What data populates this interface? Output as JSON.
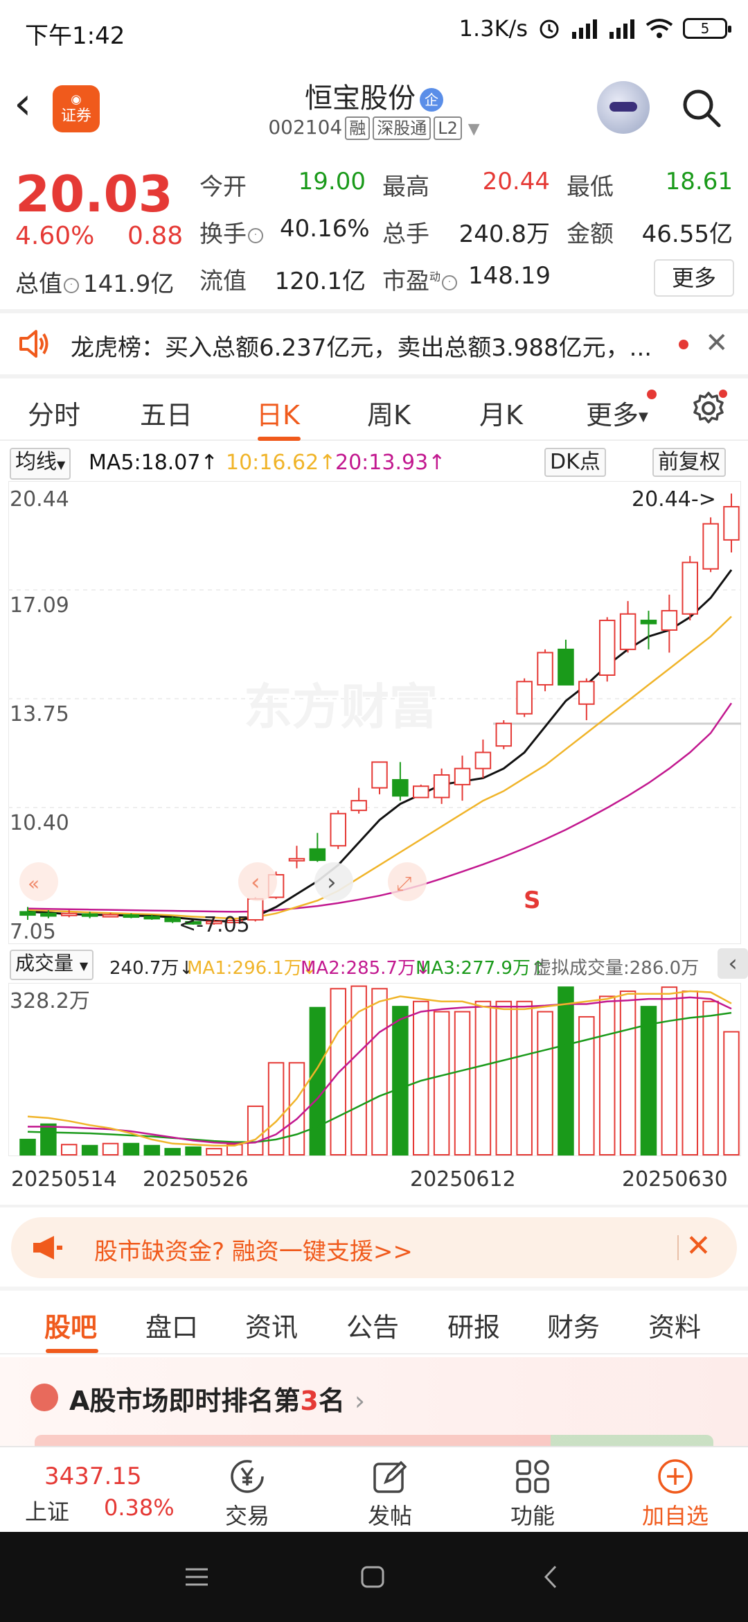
{
  "status_bar": {
    "time": "下午1:42",
    "net_speed": "1.3K/s",
    "battery": "5"
  },
  "header": {
    "app_logo_label": "证券",
    "stock_name": "恒宝股份",
    "qi_badge": "企",
    "stock_code": "002104",
    "tags": [
      "融",
      "深股通",
      "L2"
    ]
  },
  "quote": {
    "price": "20.03",
    "change_pct": "4.60%",
    "change": "0.88",
    "stats": [
      {
        "label": "今开",
        "value": "19.00",
        "color": "#1a9a1a"
      },
      {
        "label": "最高",
        "value": "20.44",
        "color": "#e53935"
      },
      {
        "label": "最低",
        "value": "18.61",
        "color": "#1a9a1a"
      },
      {
        "label": "换手",
        "value": "40.16%",
        "color": "#222222"
      },
      {
        "label": "总手",
        "value": "240.8万",
        "color": "#222222"
      },
      {
        "label": "金额",
        "value": "46.55亿",
        "color": "#222222"
      },
      {
        "label": "流值",
        "value": "120.1亿",
        "color": "#222222"
      },
      {
        "label": "市盈",
        "value": "148.19",
        "color": "#222222"
      }
    ],
    "total_cap_label": "总值",
    "total_cap_value": "141.9亿",
    "pe_superscript": "动",
    "more_label": "更多"
  },
  "dragon_tiger": {
    "text": "龙虎榜：买入总额6.237亿元，卖出总额3.988亿元，..."
  },
  "period_tabs": [
    "分时",
    "五日",
    "日K",
    "周K",
    "月K",
    "更多"
  ],
  "period_active": "日K",
  "ma_legend": {
    "selector": "均线",
    "ma5": "MA5:18.07",
    "ma10": "10:16.62",
    "ma20": "20:13.93",
    "dk_button": "DK点",
    "adjust_button": "前复权"
  },
  "colors": {
    "up": "#e53935",
    "down": "#1a9a1a",
    "ma5": "#111111",
    "ma10": "#f0b429",
    "ma20": "#c2188f",
    "accent": "#f05a1c"
  },
  "kline_axis": {
    "y_ticks": [
      "20.44",
      "17.09",
      "13.75",
      "10.40",
      "7.05"
    ],
    "high_marker": "20.44->",
    "low_marker": "<-7.05",
    "watermark": "东方财富",
    "sell_marker": "S"
  },
  "chart_data": {
    "type": "candlestick",
    "ylim": [
      7.05,
      20.44
    ],
    "candles": [
      {
        "o": 7.45,
        "c": 7.35,
        "h": 7.6,
        "l": 7.2
      },
      {
        "o": 7.4,
        "c": 7.32,
        "h": 7.5,
        "l": 7.25
      },
      {
        "o": 7.35,
        "c": 7.4,
        "h": 7.5,
        "l": 7.28
      },
      {
        "o": 7.38,
        "c": 7.32,
        "h": 7.45,
        "l": 7.25
      },
      {
        "o": 7.33,
        "c": 7.36,
        "h": 7.42,
        "l": 7.28
      },
      {
        "o": 7.35,
        "c": 7.3,
        "h": 7.4,
        "l": 7.25
      },
      {
        "o": 7.3,
        "c": 7.25,
        "h": 7.36,
        "l": 7.2
      },
      {
        "o": 7.25,
        "c": 7.15,
        "h": 7.3,
        "l": 7.1
      },
      {
        "o": 7.14,
        "c": 7.1,
        "h": 7.2,
        "l": 7.05
      },
      {
        "o": 7.1,
        "c": 7.15,
        "h": 7.2,
        "l": 7.05
      },
      {
        "o": 7.14,
        "c": 7.18,
        "h": 7.22,
        "l": 7.1
      },
      {
        "o": 7.2,
        "c": 7.85,
        "h": 7.9,
        "l": 7.15
      },
      {
        "o": 7.9,
        "c": 8.6,
        "h": 8.7,
        "l": 7.85
      },
      {
        "o": 9.1,
        "c": 9.1,
        "h": 9.5,
        "l": 8.8
      },
      {
        "o": 9.4,
        "c": 9.05,
        "h": 9.9,
        "l": 9.0
      },
      {
        "o": 9.5,
        "c": 10.5,
        "h": 10.6,
        "l": 9.4
      },
      {
        "o": 10.6,
        "c": 10.9,
        "h": 11.3,
        "l": 10.5
      },
      {
        "o": 11.3,
        "c": 12.1,
        "h": 12.1,
        "l": 11.1
      },
      {
        "o": 11.55,
        "c": 11.05,
        "h": 12.1,
        "l": 10.9
      },
      {
        "o": 11.0,
        "c": 11.35,
        "h": 11.4,
        "l": 11.0
      },
      {
        "o": 11.0,
        "c": 11.7,
        "h": 11.9,
        "l": 10.8
      },
      {
        "o": 11.4,
        "c": 11.9,
        "h": 12.3,
        "l": 10.9
      },
      {
        "o": 11.9,
        "c": 12.4,
        "h": 12.8,
        "l": 11.6
      },
      {
        "o": 12.6,
        "c": 13.3,
        "h": 13.4,
        "l": 12.5
      },
      {
        "o": 13.6,
        "c": 14.6,
        "h": 14.7,
        "l": 13.5
      },
      {
        "o": 14.5,
        "c": 15.5,
        "h": 15.6,
        "l": 14.3
      },
      {
        "o": 15.6,
        "c": 14.5,
        "h": 15.9,
        "l": 14.5
      },
      {
        "o": 13.9,
        "c": 14.6,
        "h": 14.7,
        "l": 13.4
      },
      {
        "o": 14.8,
        "c": 16.5,
        "h": 16.6,
        "l": 14.6
      },
      {
        "o": 15.6,
        "c": 16.7,
        "h": 17.1,
        "l": 15.5
      },
      {
        "o": 16.5,
        "c": 16.4,
        "h": 16.8,
        "l": 15.6
      },
      {
        "o": 16.2,
        "c": 16.8,
        "h": 17.3,
        "l": 15.5
      },
      {
        "o": 16.7,
        "c": 18.3,
        "h": 18.5,
        "l": 16.5
      },
      {
        "o": 18.1,
        "c": 19.5,
        "h": 19.7,
        "l": 18.0
      },
      {
        "o": 19.0,
        "c": 20.03,
        "h": 20.44,
        "l": 18.61
      }
    ],
    "ma5": [
      7.45,
      7.42,
      7.38,
      7.36,
      7.35,
      7.33,
      7.32,
      7.28,
      7.22,
      7.17,
      7.14,
      7.3,
      7.6,
      8.0,
      8.4,
      8.9,
      9.6,
      10.3,
      10.8,
      11.1,
      11.4,
      11.5,
      11.6,
      11.9,
      12.4,
      13.2,
      14.0,
      14.5,
      15.1,
      15.6,
      16.0,
      16.2,
      16.6,
      17.2,
      18.07
    ],
    "ma10": [
      7.5,
      7.48,
      7.46,
      7.43,
      7.41,
      7.39,
      7.37,
      7.34,
      7.3,
      7.27,
      7.24,
      7.28,
      7.4,
      7.6,
      7.8,
      8.1,
      8.5,
      8.9,
      9.3,
      9.7,
      10.1,
      10.5,
      10.9,
      11.2,
      11.6,
      12.0,
      12.5,
      13.0,
      13.5,
      14.0,
      14.5,
      15.0,
      15.5,
      16.0,
      16.62
    ],
    "ma20": [
      7.55,
      7.54,
      7.53,
      7.52,
      7.51,
      7.5,
      7.49,
      7.48,
      7.47,
      7.46,
      7.45,
      7.46,
      7.5,
      7.56,
      7.63,
      7.72,
      7.83,
      7.95,
      8.1,
      8.28,
      8.48,
      8.7,
      8.92,
      9.16,
      9.42,
      9.7,
      10.0,
      10.33,
      10.68,
      11.05,
      11.45,
      11.9,
      12.4,
      13.0,
      13.93
    ]
  },
  "volume": {
    "selector": "成交量",
    "current": "240.7万",
    "ma1": "MA1:296.1万",
    "ma2": "MA2:285.7万",
    "ma3": "MA3:277.9万",
    "virtual": "虚拟成交量:286.0万",
    "y_max_label": "328.2万",
    "ylim": [
      0,
      328.2
    ],
    "bars": [
      30,
      60,
      20,
      18,
      22,
      22,
      18,
      12,
      15,
      12,
      20,
      95,
      180,
      180,
      288,
      325,
      330,
      325,
      290,
      300,
      280,
      280,
      300,
      300,
      300,
      280,
      328,
      270,
      310,
      320,
      290,
      328,
      320,
      300,
      240.7
    ],
    "ma1_line": [
      75,
      72,
      66,
      58,
      52,
      42,
      30,
      22,
      20,
      18,
      18,
      30,
      65,
      110,
      170,
      240,
      280,
      300,
      310,
      305,
      300,
      300,
      290,
      285,
      285,
      290,
      295,
      300,
      305,
      315,
      315,
      315,
      320,
      318,
      296.1
    ],
    "ma2_line": [
      55,
      55,
      54,
      52,
      50,
      46,
      40,
      34,
      28,
      24,
      22,
      24,
      40,
      70,
      110,
      160,
      200,
      240,
      265,
      280,
      285,
      288,
      290,
      290,
      290,
      292,
      295,
      295,
      300,
      302,
      305,
      305,
      308,
      305,
      285.7
    ],
    "ma3_line": [
      45,
      44,
      43,
      42,
      40,
      38,
      36,
      33,
      30,
      27,
      25,
      25,
      30,
      40,
      55,
      75,
      95,
      115,
      130,
      145,
      155,
      165,
      175,
      185,
      195,
      205,
      215,
      225,
      235,
      245,
      255,
      262,
      268,
      272,
      277.9
    ]
  },
  "date_axis": [
    "20250514",
    "20250526",
    "20250612",
    "20250630"
  ],
  "margin_banner": {
    "text": "股市缺资金? 融资一键支援>>"
  },
  "section_tabs": [
    "股吧",
    "盘口",
    "资讯",
    "公告",
    "研报",
    "财务",
    "资料"
  ],
  "section_active": "股吧",
  "ranking": {
    "prefix": "A股市场即时排名第",
    "rank": "3",
    "suffix": "名"
  },
  "bottom_bar": {
    "index_value": "3437.15",
    "index_label": "上证",
    "index_pct": "0.38%",
    "nav": [
      {
        "label": "交易",
        "icon": "yen-icon"
      },
      {
        "label": "发帖",
        "icon": "edit-icon"
      },
      {
        "label": "功能",
        "icon": "grid-icon"
      },
      {
        "label": "加自选",
        "icon": "plus-circle-icon"
      }
    ]
  }
}
